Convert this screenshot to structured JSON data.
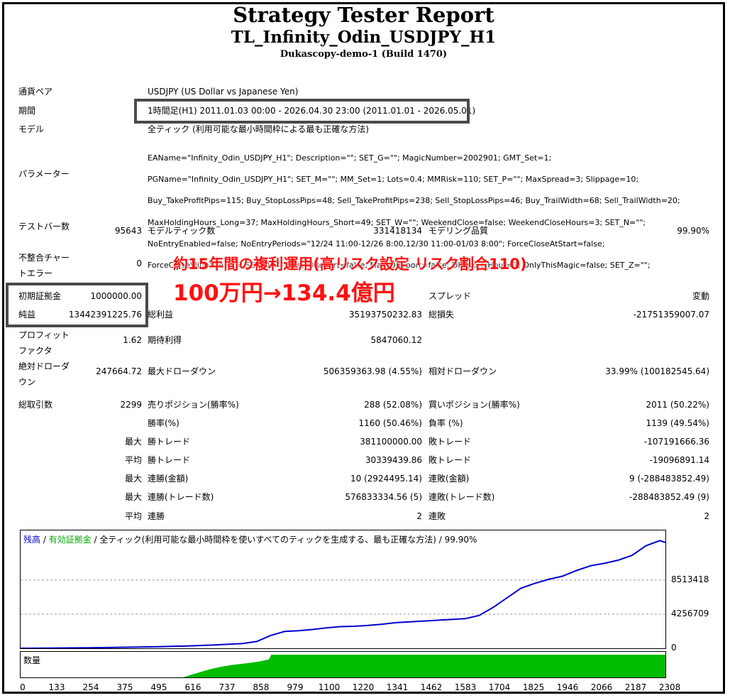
{
  "header": {
    "title": "Strategy Tester Report",
    "subtitle": "TL_Infinity_Odin_USDJPY_H1",
    "server": "Dukascopy-demo-1 (Build 1470)"
  },
  "info": {
    "pair_label": "通貨ペア",
    "pair_value": "USDJPY (US Dollar vs Japanese Yen)",
    "period_label": "期間",
    "period_value": "1時間足(H1) 2011.01.03 00:00 - 2026.04.30 23:00 (2011.01.01 - 2026.05.01)",
    "model_label": "モデル",
    "model_value": "全ティック (利用可能な最小時間枠による最も正確な方法)",
    "param_label": "パラメーター",
    "params": [
      "EAName=\"Infinity_Odin_USDJPY_H1\"; Description=\"\"; SET_G=\"\"; MagicNumber=2002901; GMT_Set=1;",
      "PGName=\"Infinity_Odin_USDJPY_H1\"; SET_M=\"\"; MM_Set=1; Lots=0.4; MMRisk=110; SET_P=\"\"; MaxSpread=3; Slippage=10;",
      "Buy_TakeProfitPips=115; Buy_StopLossPips=48; Sell_TakeProfitPips=238; Sell_StopLossPips=46; Buy_TrailWidth=68; Sell_TrailWidth=20;",
      "MaxHoldingHours_Long=37; MaxHoldingHours_Short=49; SET_W=\"\"; WeekendClose=false; WeekendCloseHours=3; SET_N=\"\";",
      "NoEntryEnabled=false; NoEntryPeriods=\"12/24 11:00-12/26 8:00,12/30 11:00-01/03 8:00\"; ForceCloseAtStart=false;",
      "ForceCloseSlippage=15; SET_D=\"\"; Test_DReport=false; Mail_DReport=false; DReport_Hour=7; OnlyThisMagic=false; SET_Z=\"\";"
    ]
  },
  "stats": {
    "bars_label": "テストバー数",
    "bars": "95643",
    "ticks_label": "モデルティック数",
    "ticks": "331418134",
    "quality_label": "モデリング品質",
    "quality": "99.90%",
    "mismatch_label": "不整合チャートエラー",
    "mismatch": "0",
    "deposit_label": "初期証拠金",
    "deposit": "1000000.00",
    "spread_label": "スプレッド",
    "spread": "変動",
    "net_label": "純益",
    "net": "13442391225.76",
    "gross_profit_label": "総利益",
    "gross_profit": "35193750232.83",
    "gross_loss_label": "総損失",
    "gross_loss": "-21751359007.07",
    "pf_label": "プロフィットファクタ",
    "pf": "1.62",
    "expected_label": "期待利得",
    "expected": "5847060.12",
    "abs_dd_label": "絶対ドローダウン",
    "abs_dd": "247664.72",
    "max_dd_label": "最大ドローダウン",
    "max_dd": "506359363.98 (4.55%)",
    "rel_dd_label": "相対ドローダウン",
    "rel_dd": "33.99% (100182545.64)",
    "trades_label": "総取引数",
    "trades": "2299",
    "short_label": "売りポジション(勝率%)",
    "short": "288 (52.08%)",
    "long_label": "買いポジション(勝率%)",
    "long": "2011 (50.22%)",
    "win_label": "勝率(%)",
    "win": "1160 (50.46%)",
    "loss_label": "負率 (%)",
    "loss": "1139 (49.54%)",
    "max_prefix": "最大",
    "avg_prefix": "平均",
    "max_win_label": "勝トレード",
    "max_win": "381100000.00",
    "max_loss_label": "敗トレード",
    "max_loss": "-107191666.36",
    "avg_win_label": "勝トレード",
    "avg_win": "30339439.86",
    "avg_loss_label": "敗トレード",
    "avg_loss": "-19096891.14",
    "consec_win_amt_label": "連勝(金額)",
    "consec_win_amt": "10 (2924495.14)",
    "consec_loss_amt_label": "連敗(金額)",
    "consec_loss_amt": "9 (-288483852.49)",
    "consec_win_trd_label": "連勝(トレード数)",
    "consec_win_trd": "576833334.56 (5)",
    "consec_loss_trd_label": "連敗(トレード数)",
    "consec_loss_trd": "-288483852.49 (9)",
    "avg_consec_win_label": "連勝",
    "avg_consec_win": "2",
    "avg_consec_loss_label": "連敗",
    "avg_consec_loss": "2"
  },
  "overlay": {
    "line1": "約15年間の複利運用(高リスク設定 リスク割合110)",
    "line2": "100万円→134.4億円"
  },
  "chart_legend": {
    "balance": "残高",
    "sep1": " / ",
    "equity": "有効証拠金",
    "rest": " / 全ティック(利用可能な最小時間枠を使いすべてのティックを生成する、最も正確な方法) / 99.90%",
    "volume_label": "数量",
    "balance_color": "#0000cc",
    "equity_color": "#00aa00"
  },
  "chart_data": {
    "type": "line",
    "x_ticks": [
      "0",
      "133",
      "254",
      "375",
      "495",
      "616",
      "737",
      "858",
      "979",
      "1100",
      "1220",
      "1341",
      "1462",
      "1583",
      "1704",
      "1825",
      "1946",
      "2066",
      "2187",
      "2308"
    ],
    "y_ticks": [
      "8513418",
      "4256709",
      "0"
    ],
    "x": [
      0,
      100,
      200,
      300,
      400,
      500,
      600,
      700,
      800,
      850,
      900,
      950,
      1000,
      1050,
      1100,
      1150,
      1200,
      1250,
      1300,
      1350,
      1400,
      1450,
      1500,
      1550,
      1600,
      1650,
      1700,
      1750,
      1800,
      1850,
      1900,
      1950,
      2000,
      2050,
      2100,
      2150,
      2200,
      2250,
      2300,
      2320
    ],
    "series": [
      {
        "name": "残高",
        "color": "#0000cc",
        "values": [
          0,
          20000,
          50000,
          90000,
          140000,
          200000,
          290000,
          420000,
          600000,
          850000,
          1600000,
          2100000,
          2200000,
          2350000,
          2550000,
          2700000,
          2750000,
          2850000,
          3000000,
          3200000,
          3300000,
          3400000,
          3500000,
          3600000,
          3700000,
          4100000,
          5100000,
          6300000,
          7500000,
          8100000,
          8600000,
          9000000,
          9700000,
          10300000,
          10600000,
          11000000,
          11600000,
          12800000,
          13442391,
          13200000
        ]
      }
    ],
    "volume_start_x": 540,
    "volume_full_x": 900,
    "ylim": [
      0,
      14000000
    ],
    "xlim": [
      0,
      2320
    ]
  }
}
